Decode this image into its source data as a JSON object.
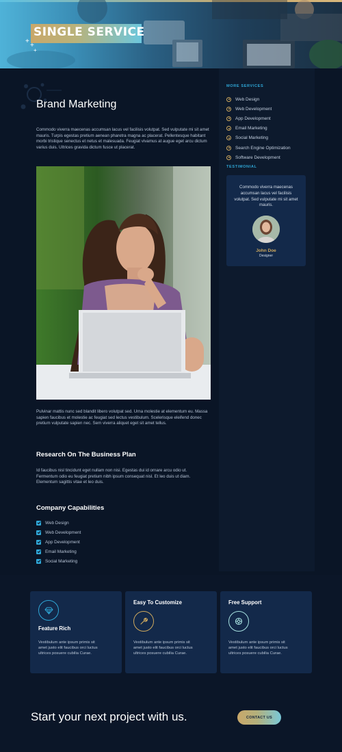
{
  "hero": {
    "title": "SINGLE SERVICE"
  },
  "main": {
    "title": "Brand Marketing",
    "intro": "Commodo viverra maecenas accumsan lacus vel facilisis volutpat. Sed vulputate mi sit amet mauris. Turpis egestas pretium aenean pharetra magna ac placerat. Pellentesque habitant morbi tristique senectus et netus et malesuada. Feugiat vivamus at augue eget arcu dictum varius duis. Ultrices gravida dictum fusce ut placerat.",
    "after_photo": "Pulvinar mattis nunc sed blandit libero volutpat sed. Urna molestie at elementum eu. Massa sapien faucibus et molestie ac feugiat sed lectus vestibulum. Scelerisque eleifend donec pretium vulputate sapien nec. Sem viverra aliquet eget sit amet tellus.",
    "research_title": "Research On The Business Plan",
    "research_text": "Id faucibus nisl tincidunt eget nullam non nisi. Egestas dui id ornare arcu odio ut. Fermentum odio eu feugiat pretium nibh ipsum consequat nisl. Et leo duis ut diam. Elementum sagittis vitae et leo duis.",
    "capabilities_title": "Company Capabilities",
    "capabilities": [
      "Web Design",
      "Web Development",
      "App Development",
      "Email Marketing",
      "Social Marketing"
    ]
  },
  "sidebar": {
    "services_label": "MORE SERVICES",
    "services": [
      "Web Design",
      "Web Development",
      "App Development",
      "Email Marketing",
      "Social Marketing",
      "Search Engine Optimization",
      "Software Development"
    ],
    "testimonial_label": "TESTIMONIAL",
    "testimonial": {
      "quote": "Commodo viverra maecenas accumsan lacus vel facilisis volutpat. Sed vulputate mi sit amet mauris.",
      "name": "John Doe",
      "role": "Designer"
    }
  },
  "features": [
    {
      "title": "Feature Rich",
      "icon": "diamond-icon",
      "text": "Vestibulum ante ipsum primis sit amet justo elit faucibus orci luctus ultrices posuere cubilia Curae."
    },
    {
      "title": "Easy To Customize",
      "icon": "wrench-icon",
      "text": "Vestibulum ante ipsum primis sit amet justo elit faucibus orci luctus ultrices posuere cubilia Curae."
    },
    {
      "title": "Free Support",
      "icon": "support-icon",
      "text": "Vestibulum ante ipsum primis sit amet justo elit faucibus orci luctus ultrices posuere cubilia Curae."
    }
  ],
  "cta": {
    "text": "Start your next project with us.",
    "button": "CONTACT US"
  },
  "colors": {
    "background": "#0b1628",
    "card": "#13294a",
    "accent_blue": "#2fa7d7",
    "accent_gold": "#cfa95e"
  }
}
